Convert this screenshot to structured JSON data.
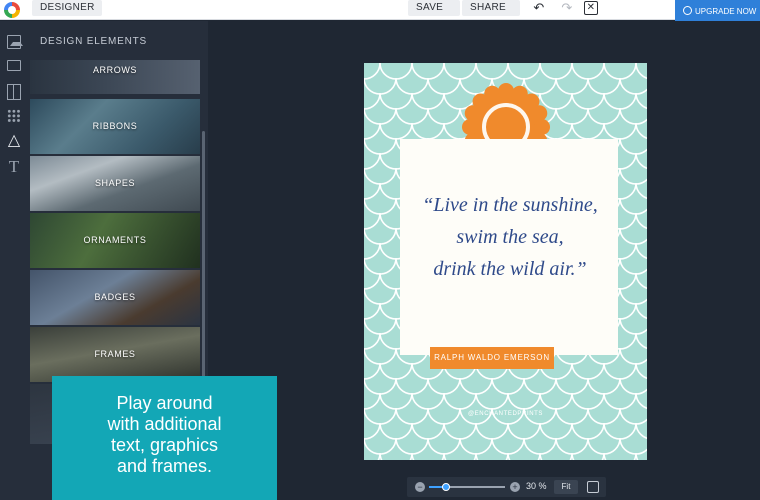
{
  "toolbar": {
    "designer_label": "DESIGNER",
    "save_label": "SAVE",
    "share_label": "SHARE",
    "upgrade_label": "UPGRADE NOW"
  },
  "rail": {
    "icons": [
      "image-icon",
      "folder-icon",
      "layout-icon",
      "grid-icon",
      "triangle-icon",
      "text-icon"
    ]
  },
  "panel": {
    "title": "DESIGN ELEMENTS",
    "items": [
      {
        "label": "ARROWS"
      },
      {
        "label": "RIBBONS"
      },
      {
        "label": "SHAPES"
      },
      {
        "label": "ORNAMENTS"
      },
      {
        "label": "BADGES"
      },
      {
        "label": "FRAMES"
      }
    ]
  },
  "poster": {
    "quote": "“Live in the sunshine,\nswim the sea,\ndrink the wild air.”",
    "author": "RALPH WALDO EMERSON",
    "handle": "@ENCHANTEDPRINTS",
    "colors": {
      "background": "#a9ddd4",
      "accent": "#f08a2c",
      "ink": "#2f4a8a"
    }
  },
  "zoom": {
    "value": "30 %",
    "fit_label": "Fit",
    "slider_fraction": 0.23
  },
  "promo": {
    "text": "Play around\nwith additional\ntext, graphics\nand frames."
  }
}
